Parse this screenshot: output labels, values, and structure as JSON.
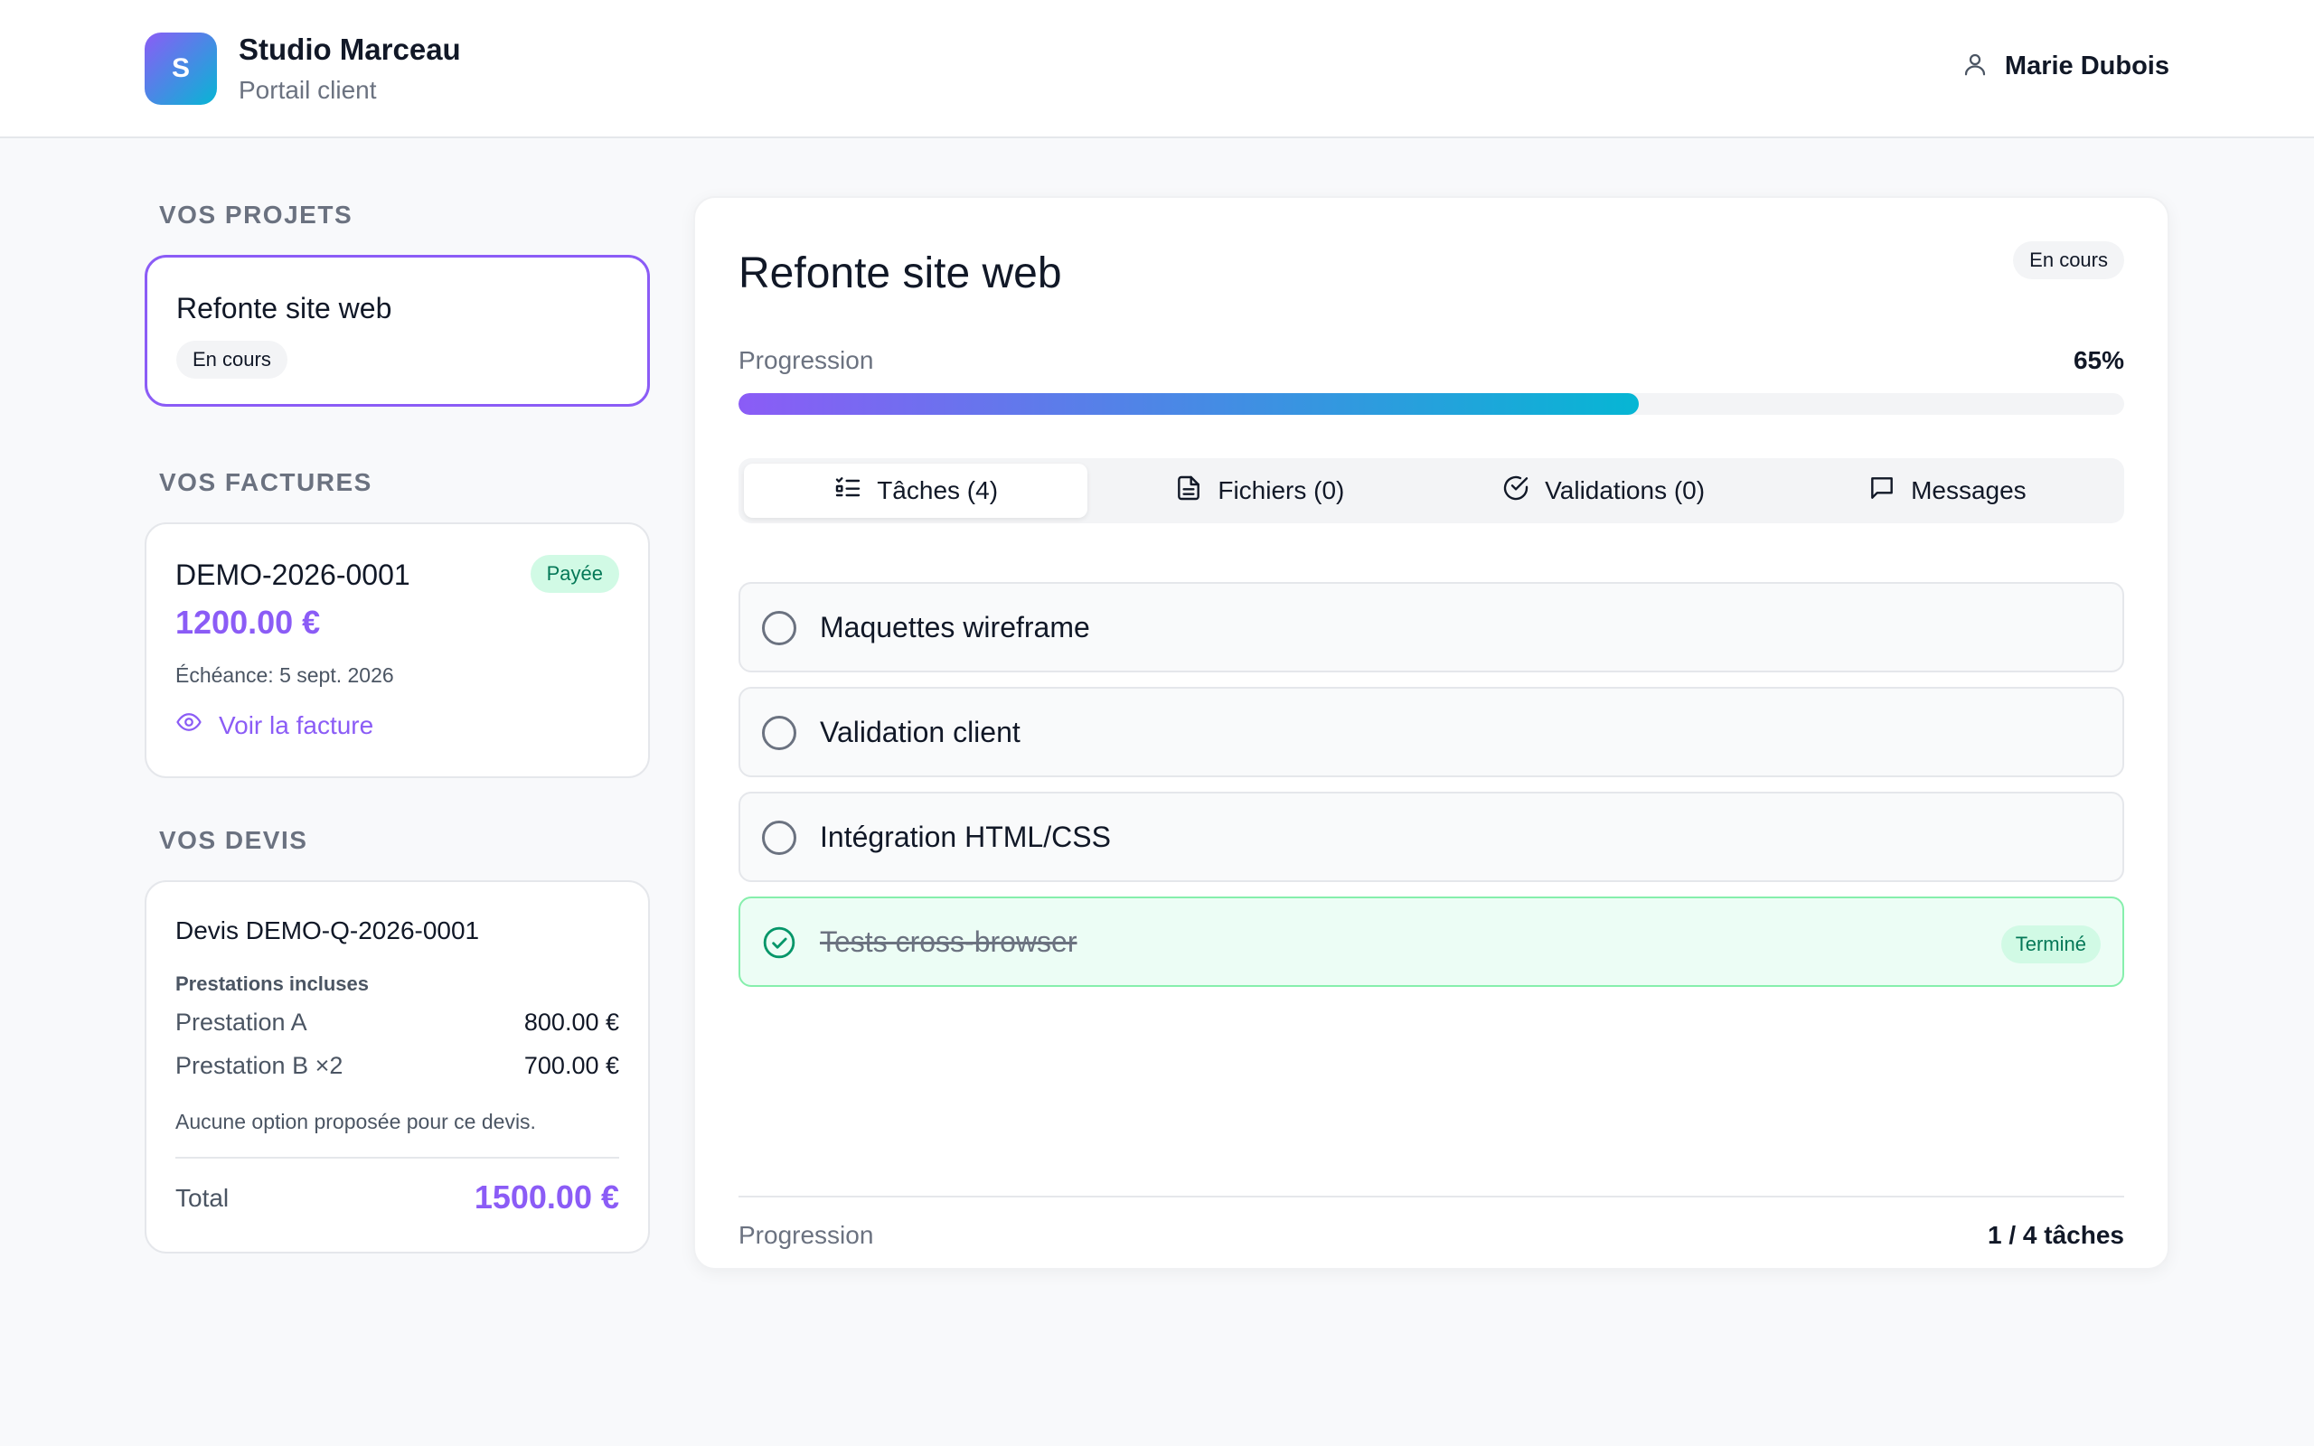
{
  "colors": {
    "accent": "#8b5cf6",
    "accent_gradient_end": "#06b6d4",
    "success": "#047857",
    "success_bg": "#d1fae5"
  },
  "header": {
    "logo_letter": "S",
    "brand_name": "Studio Marceau",
    "brand_subtitle": "Portail client",
    "user_icon": "user-icon",
    "user_name": "Marie Dubois"
  },
  "sidebar": {
    "projects_title": "VOS PROJETS",
    "project": {
      "title": "Refonte site web",
      "status": "En cours"
    },
    "invoices_title": "VOS FACTURES",
    "invoice": {
      "number": "DEMO-2026-0001",
      "status": "Payée",
      "amount": "1200.00 €",
      "due": "Échéance: 5 sept. 2026",
      "link_icon": "eye-icon",
      "link_label": "Voir la facture"
    },
    "quotes_title": "VOS DEVIS",
    "quote": {
      "title": "Devis DEMO-Q-2026-0001",
      "services_label": "Prestations incluses",
      "lines": [
        {
          "name": "Prestation A",
          "price": "800.00 €"
        },
        {
          "name": "Prestation B ×2",
          "price": "700.00 €"
        }
      ],
      "note": "Aucune option proposée pour ce devis.",
      "total_label": "Total",
      "total_value": "1500.00 €"
    }
  },
  "main": {
    "title": "Refonte site web",
    "status": "En cours",
    "progress_label": "Progression",
    "progress_value": "65%",
    "progress_percent": 65,
    "tabs": [
      {
        "label": "Tâches (4)",
        "icon": "checklist-icon",
        "active": true
      },
      {
        "label": "Fichiers (0)",
        "icon": "file-icon",
        "active": false
      },
      {
        "label": "Validations (0)",
        "icon": "check-circle-icon",
        "active": false
      },
      {
        "label": "Messages",
        "icon": "message-icon",
        "active": false
      }
    ],
    "tasks": [
      {
        "label": "Maquettes wireframe",
        "done": false
      },
      {
        "label": "Validation client",
        "done": false
      },
      {
        "label": "Intégration HTML/CSS",
        "done": false
      },
      {
        "label": "Tests cross-browser",
        "done": true,
        "badge": "Terminé"
      }
    ],
    "footer_label": "Progression",
    "footer_value": "1 / 4 tâches"
  }
}
